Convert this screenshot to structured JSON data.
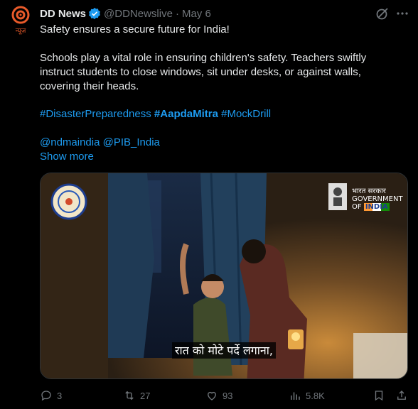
{
  "author": {
    "name": "DD News",
    "handle": "@DDNewslive",
    "separator": "·",
    "date": "May 6",
    "avatar_label": "न्यूज़"
  },
  "tweet": {
    "line1": "Safety ensures a secure future for India!",
    "line2": "Schools play a vital role in ensuring children's safety. Teachers swiftly",
    "line3": "instruct students to close windows, sit under desks, or against walls,",
    "line4": "covering their heads.",
    "hashtags": [
      "#DisasterPreparedness",
      "#AapdaMitra",
      "#MockDrill"
    ],
    "mentions": [
      "@ndmaindia",
      "@PIB_India"
    ],
    "show_more": "Show more"
  },
  "media": {
    "caption": "रात को मोटे पर्दे लगाना,",
    "gov_hindi": "भारत सरकार",
    "gov_line1": "GOVERNMENT",
    "gov_line2_prefix": "OF",
    "gov_line2_country": "INDIA"
  },
  "actions": {
    "replies": "3",
    "reposts": "27",
    "likes": "93",
    "views": "5.8K"
  },
  "colors": {
    "link": "#1d9bf0",
    "muted": "#71767b",
    "text": "#e7e9ea",
    "verified": "#1d9bf0"
  },
  "icons": [
    "dd-logo-icon",
    "verified-badge-icon",
    "grok-icon",
    "more-icon",
    "reply-icon",
    "repost-icon",
    "like-icon",
    "views-icon",
    "bookmark-icon",
    "share-icon"
  ]
}
